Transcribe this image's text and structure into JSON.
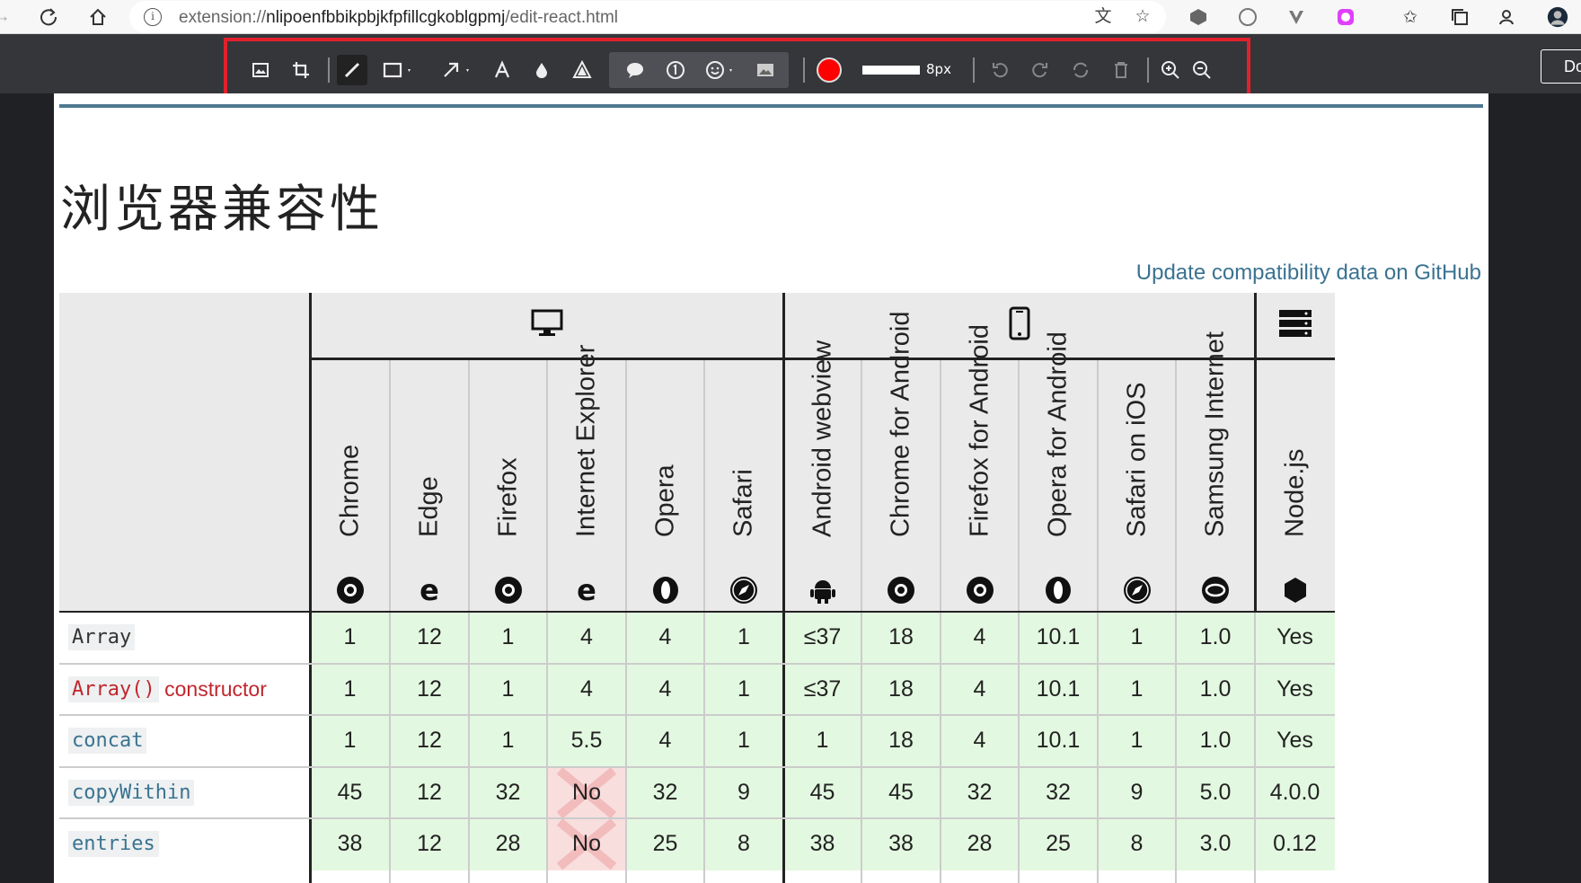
{
  "browser": {
    "url_prefix": "extension://",
    "url_host": "nlipoenfbbikpbjkfpfillcgkoblgpmj",
    "url_path": "/edit-react.html",
    "partial_button": "Do"
  },
  "editor_toolbar": {
    "line_size_label": "8px",
    "color": "#ff0000",
    "frame_color": "#e2202c"
  },
  "page": {
    "title": "浏览器兼容性",
    "github_link": "Update compatibility data on GitHub"
  },
  "table": {
    "browsers": [
      "Chrome",
      "Edge",
      "Firefox",
      "Internet Explorer",
      "Opera",
      "Safari",
      "Android webview",
      "Chrome for Android",
      "Firefox for Android",
      "Opera for Android",
      "Safari on iOS",
      "Samsung Internet",
      "Node.js"
    ],
    "platforms": [
      "desktop-icon",
      "mobile-icon",
      "server-icon"
    ],
    "rows": [
      {
        "feature": "Array",
        "style": "plain",
        "suffix": "",
        "values": [
          "1",
          "12",
          "1",
          "4",
          "4",
          "1",
          "≤37",
          "18",
          "4",
          "10.1",
          "1",
          "1.0",
          "Yes"
        ]
      },
      {
        "feature": "Array()",
        "style": "red",
        "suffix": " constructor",
        "values": [
          "1",
          "12",
          "1",
          "4",
          "4",
          "1",
          "≤37",
          "18",
          "4",
          "10.1",
          "1",
          "1.0",
          "Yes"
        ]
      },
      {
        "feature": "concat",
        "style": "link",
        "suffix": "",
        "values": [
          "1",
          "12",
          "1",
          "5.5",
          "4",
          "1",
          "1",
          "18",
          "4",
          "10.1",
          "1",
          "1.0",
          "Yes"
        ]
      },
      {
        "feature": "copyWithin",
        "style": "link",
        "suffix": "",
        "values": [
          "45",
          "12",
          "32",
          "No",
          "32",
          "9",
          "45",
          "45",
          "32",
          "32",
          "9",
          "5.0",
          "4.0.0"
        ]
      },
      {
        "feature": "entries",
        "style": "link",
        "suffix": "",
        "values": [
          "38",
          "12",
          "28",
          "No",
          "25",
          "8",
          "38",
          "38",
          "28",
          "25",
          "8",
          "3.0",
          "0.12"
        ]
      }
    ]
  }
}
